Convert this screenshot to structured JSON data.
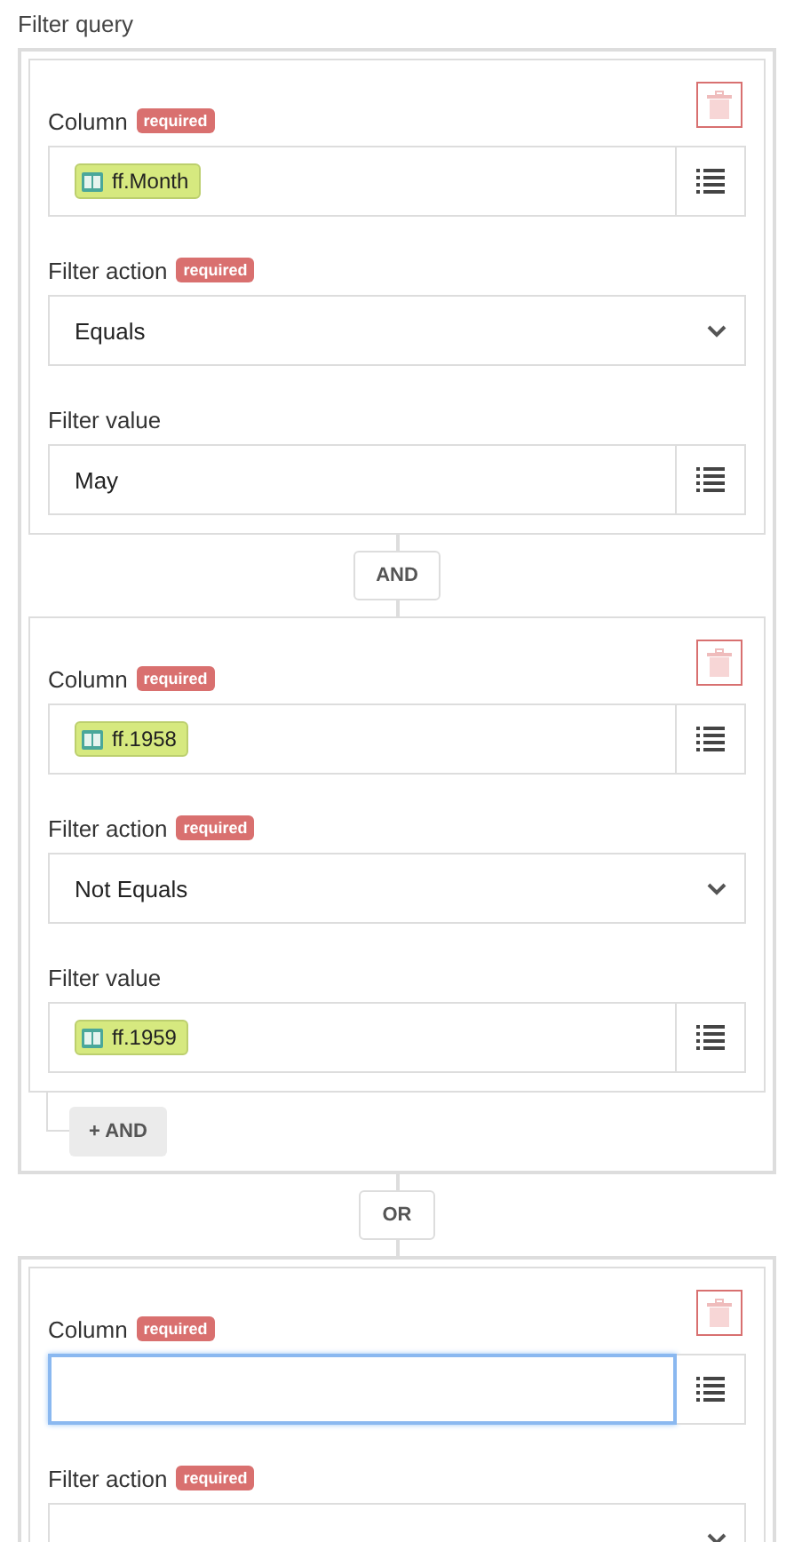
{
  "title": "Filter query",
  "groups": [
    {
      "add_button": "+ AND",
      "conditions": [
        {
          "fields": [
            {
              "kind": "picker",
              "label": "Column",
              "badge": "required",
              "chip": "ff.Month",
              "focused": false
            },
            {
              "kind": "select",
              "label": "Filter action",
              "badge": "required",
              "value": "Equals"
            },
            {
              "kind": "picker",
              "label": "Filter value",
              "value": "May",
              "focused": false
            }
          ]
        },
        {
          "joiner": "AND",
          "fields": [
            {
              "kind": "picker",
              "label": "Column",
              "badge": "required",
              "chip": "ff.1958",
              "focused": false
            },
            {
              "kind": "select",
              "label": "Filter action",
              "badge": "required",
              "value": "Not Equals"
            },
            {
              "kind": "picker",
              "label": "Filter value",
              "chip": "ff.1959",
              "focused": false
            }
          ]
        }
      ]
    },
    {
      "joiner": "OR",
      "conditions": [
        {
          "fields": [
            {
              "kind": "picker",
              "label": "Column",
              "badge": "required",
              "focused": true
            },
            {
              "kind": "select",
              "label": "Filter action",
              "badge": "required"
            }
          ]
        }
      ]
    }
  ]
}
